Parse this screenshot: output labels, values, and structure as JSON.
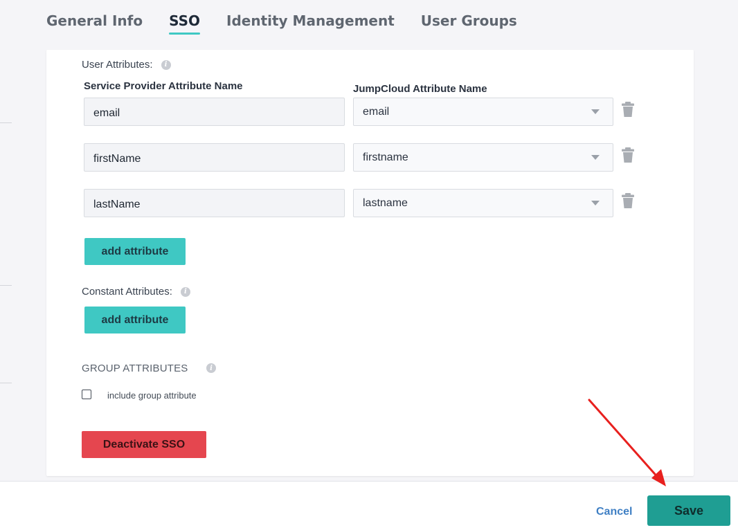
{
  "tabs": {
    "general": "General Info",
    "sso": "SSO",
    "identity": "Identity Management",
    "groups": "User Groups"
  },
  "user_attributes": {
    "label": "User Attributes:",
    "col_sp": "Service Provider Attribute Name",
    "col_jc": "JumpCloud Attribute Name",
    "rows": [
      {
        "sp": "email",
        "jc": "email"
      },
      {
        "sp": "firstName",
        "jc": "firstname"
      },
      {
        "sp": "lastName",
        "jc": "lastname"
      }
    ],
    "add_label": "add attribute"
  },
  "constant_attributes": {
    "label": "Constant Attributes:",
    "add_label": "add attribute"
  },
  "group_attributes": {
    "label": "GROUP ATTRIBUTES",
    "checkbox_label": "include group attribute",
    "checked": false
  },
  "deactivate_label": "Deactivate SSO",
  "footer": {
    "cancel": "Cancel",
    "save": "Save"
  },
  "icons": {
    "info": "info-icon",
    "trash": "trash-icon",
    "dropdown": "chevron-down-icon"
  },
  "colors": {
    "accent": "#3fc8c3",
    "save": "#1f9e93",
    "danger": "#e5464f",
    "link": "#3f7fc4",
    "annotation": "#e8201e"
  }
}
